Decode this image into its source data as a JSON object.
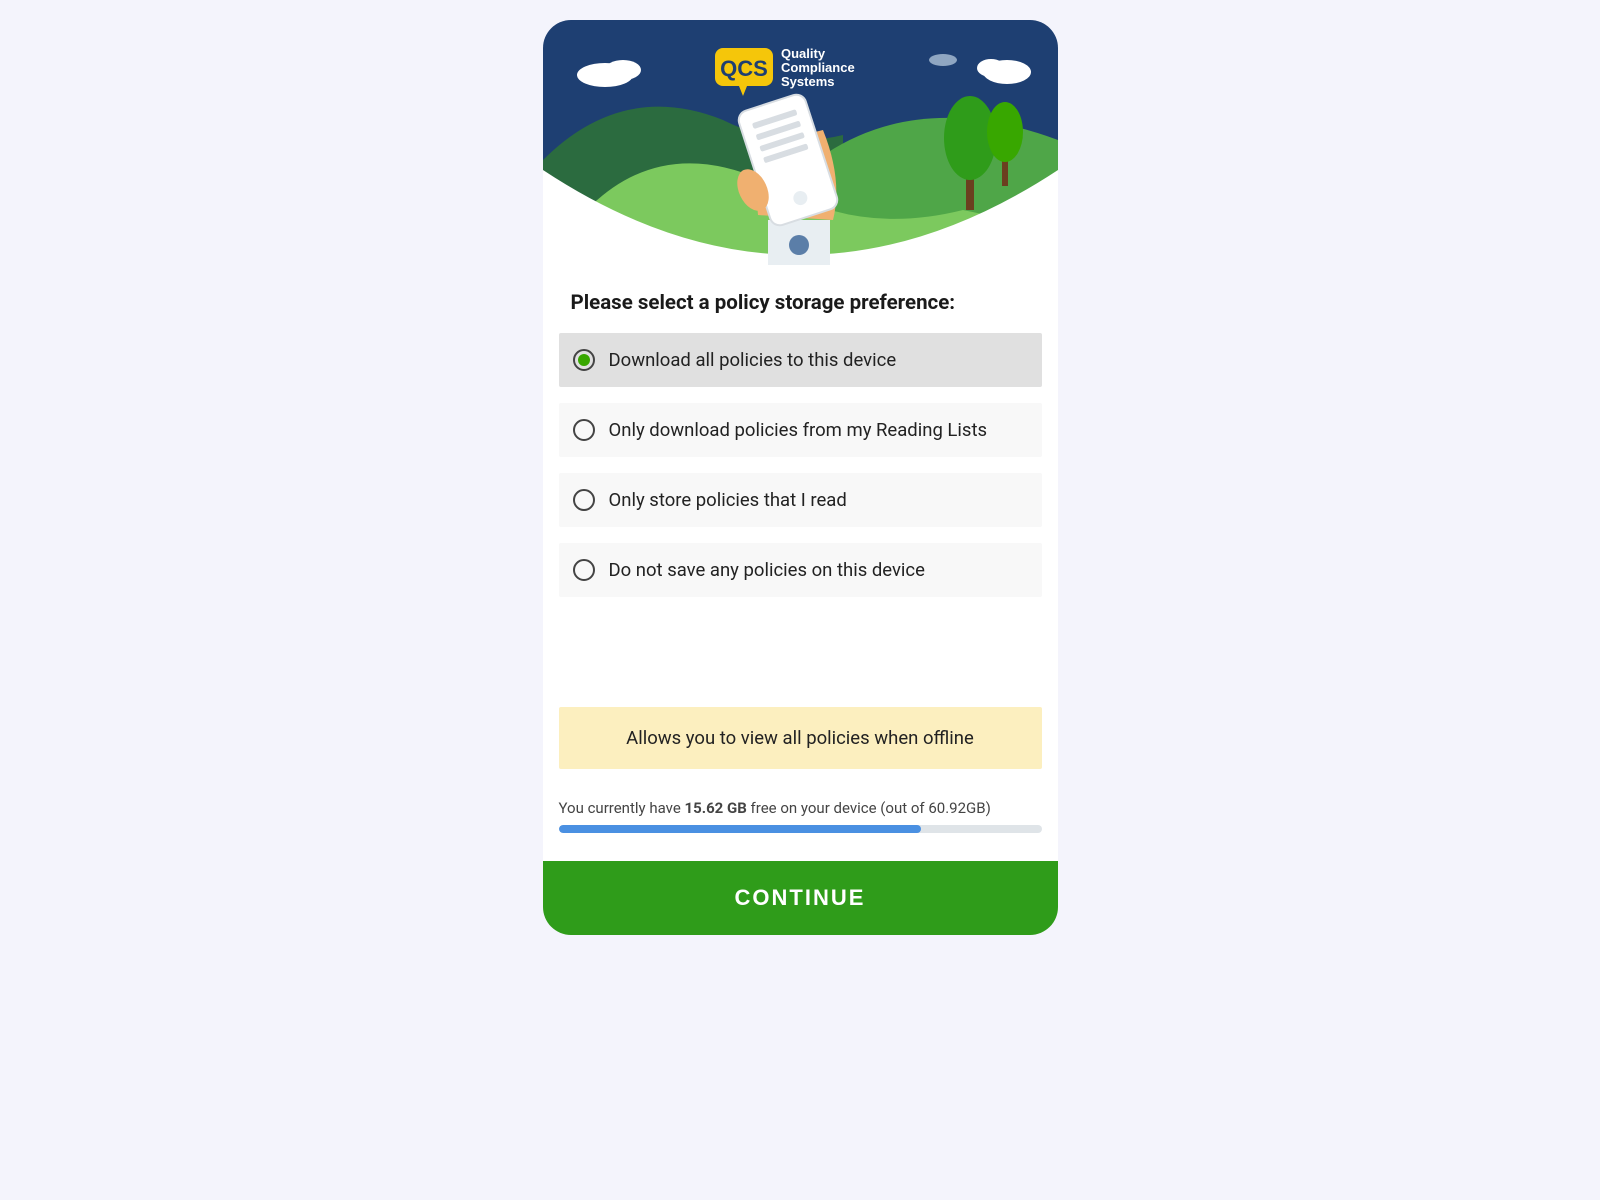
{
  "brand": {
    "badge": "QCS",
    "name_line1": "Quality",
    "name_line2": "Compliance",
    "name_line3": "Systems"
  },
  "heading": "Please select a policy storage preference:",
  "options": [
    {
      "label": "Download all policies to this device",
      "selected": true
    },
    {
      "label": "Only download policies from my Reading Lists",
      "selected": false
    },
    {
      "label": "Only store policies that I read",
      "selected": false
    },
    {
      "label": "Do not save any policies on this device",
      "selected": false
    }
  ],
  "info": "Allows you to view all policies when offline",
  "storage": {
    "prefix": "You currently have ",
    "free": "15.62 GB",
    "middle": " free on your device (out of ",
    "total": "60.92GB",
    "suffix": ")",
    "percent_used": 75
  },
  "cta": "CONTINUE"
}
